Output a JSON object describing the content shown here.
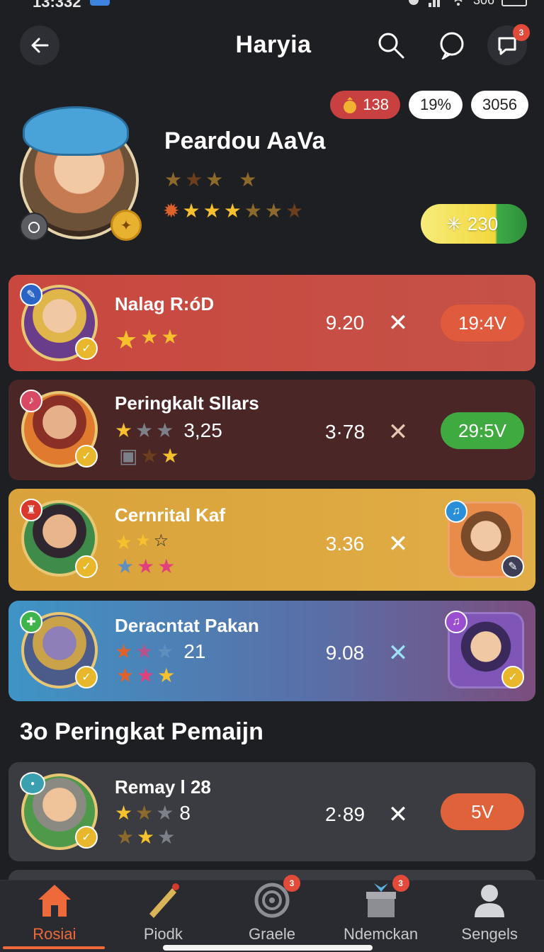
{
  "status_bar": {
    "time": "13:332",
    "battery": "306"
  },
  "header": {
    "title": "Haryia",
    "notification_count": "3"
  },
  "stats": {
    "coins": "138",
    "percent": "19%",
    "points": "3056"
  },
  "profile": {
    "name": "Peardou AaVa",
    "xp": "230"
  },
  "cards": [
    {
      "name": "Nalag R:óD",
      "score": "9.20",
      "time": "19:4V",
      "accent": "#c7453e"
    },
    {
      "name": "Peringkalt Sllars",
      "inline_value": "3,25",
      "score": "3·78",
      "time": "29:5V",
      "accent": "#4a2626"
    },
    {
      "name": "Cernrital Kaf",
      "score": "3.36",
      "accent": "#d8a33a"
    },
    {
      "name": "Deracntat Pakan",
      "inline_value": "21",
      "score": "9.08",
      "accent": "#3f8fc0"
    },
    {
      "name": "Remay l 28",
      "inline_value": "8",
      "score": "2·89",
      "time": "5V",
      "accent": "#3a3c42"
    }
  ],
  "section": {
    "title": "3o Peringkat Pemaijn"
  },
  "nav": [
    {
      "label": "Rosiai",
      "icon": "home-icon",
      "active": true
    },
    {
      "label": "Piodk",
      "icon": "brush-icon",
      "badge": ""
    },
    {
      "label": "Graele",
      "icon": "target-icon",
      "badge": "3"
    },
    {
      "label": "Ndemckan",
      "icon": "gift-box-icon",
      "badge": "3"
    },
    {
      "label": "Sengels",
      "icon": "user-icon"
    }
  ]
}
